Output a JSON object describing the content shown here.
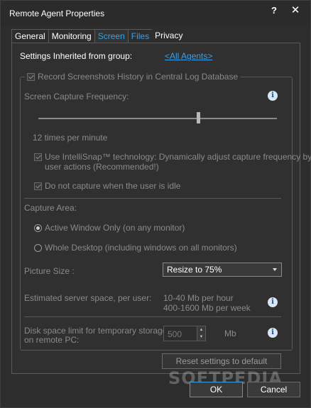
{
  "window": {
    "title": "Remote Agent Properties",
    "help_glyph": "?",
    "close_glyph": "✕"
  },
  "tabs": [
    {
      "label": "General"
    },
    {
      "label": "Monitoring"
    },
    {
      "label": "Screen"
    },
    {
      "label": "Files"
    },
    {
      "label": "Privacy"
    }
  ],
  "inherited": {
    "label": "Settings Inherited from group:",
    "link": "<All Agents>"
  },
  "record": {
    "label": "Record Screenshots History in Central Log Database",
    "checked": true
  },
  "capture_frequency": {
    "label": "Screen Capture Frequency:",
    "value_text": "12 times per minute",
    "slider_position": 0.67
  },
  "intellisnap": {
    "label_line1": "Use IntelliSnap™ technology: Dynamically adjust capture frequency by",
    "label_line2": "user actions (Recommended!)",
    "checked": true
  },
  "idle": {
    "label": "Do not capture when the user is idle",
    "checked": true
  },
  "capture_area": {
    "label": "Capture Area:",
    "options": [
      {
        "label": "Active Window Only (on any monitor)",
        "selected": true
      },
      {
        "label": "Whole Desktop (including windows on all monitors)",
        "selected": false
      }
    ]
  },
  "picture_size": {
    "label": "Picture Size :",
    "value": "Resize to 75%"
  },
  "estimated": {
    "label": "Estimated server space, per user:",
    "line1": "10-40 Mb per hour",
    "line2": "400-1600 Mb per week"
  },
  "disk_limit": {
    "label_line1": "Disk space limit for temporary storage",
    "label_line2": "on remote PC:",
    "value": "500",
    "unit": "Mb"
  },
  "buttons": {
    "reset": "Reset settings to default",
    "ok": "OK",
    "cancel": "Cancel"
  },
  "info_glyph": "i",
  "watermark": "SOFTPEDIA",
  "colors": {
    "accent": "#3aa0e8",
    "background": "#2d2d2d",
    "disabled_text": "#8a8a8a"
  }
}
